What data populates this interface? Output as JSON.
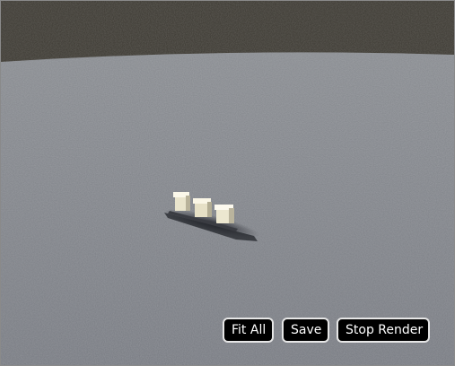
{
  "viewer": {
    "background_top_color": "#3f3c35",
    "ground_color": "#82858b",
    "model_color": "#e8e2c8",
    "shadow_color": "#2a2c33"
  },
  "toolbar": {
    "fit_all_label": "Fit All",
    "save_label": "Save",
    "stop_render_label": "Stop Render"
  }
}
